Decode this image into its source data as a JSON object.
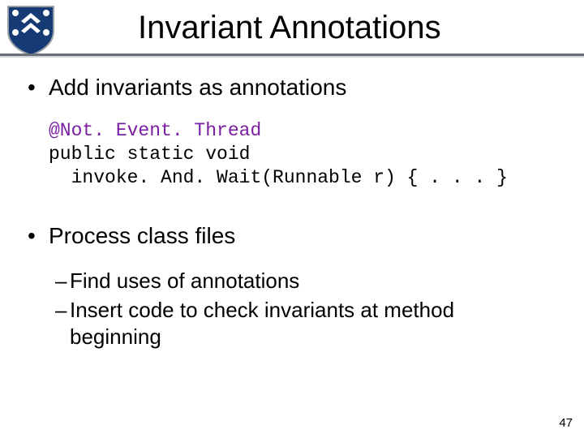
{
  "slide": {
    "title": "Invariant Annotations",
    "page_number": "47",
    "logo": {
      "bg_color": "#163b74",
      "accent_color": "#ffffff"
    },
    "bullets": [
      {
        "level": 1,
        "text": "Add invariants as annotations"
      },
      {
        "level": 1,
        "text": "Process class files"
      }
    ],
    "sub_bullets": [
      "Find uses of annotations",
      "Insert code to check invariants at method beginning"
    ],
    "code": {
      "annotation_line": "@Not. Event. Thread",
      "line2": "public static void",
      "line3": "  invoke. And. Wait(Runnable r) { . . . }"
    }
  }
}
